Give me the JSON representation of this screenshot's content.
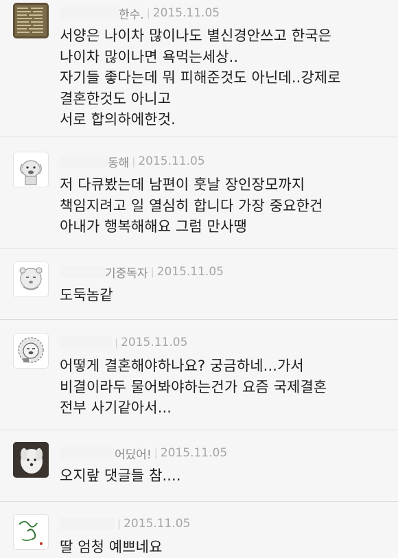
{
  "comments": [
    {
      "author": "한수.",
      "date": "2015.11.05",
      "text": "서양은 나이차 많이나도 별신경안쓰고 한국은\n나이차 많이나면 욕먹는세상..\n자기들 좋다는데 뭐 피해준것도 아닌데..강제로\n결혼한것도 아니고\n서로 합의하에한것."
    },
    {
      "author": "동해",
      "date": "2015.11.05",
      "text": "저 다큐봤는데 남편이 훗날 장인장모까지\n책임지려고 일 열심히 합니다 가장 중요한건\n아내가 행복해해요 그럼 만사땡"
    },
    {
      "author": "기중독자",
      "date": "2015.11.05",
      "text": "도둑놈같"
    },
    {
      "author": "",
      "date": "2015.11.05",
      "text": "어떻게 결혼해야하나요? 궁금하네...가서\n비결이라두 물어봐야하는건가 요즘 국제결혼\n전부 사기같아서..."
    },
    {
      "author": "어딨어!",
      "date": "2015.11.05",
      "text": "오지랖 댓글들 참...."
    },
    {
      "author": "",
      "date": "2015.11.05",
      "text": "딸 엄청 예쁘네요"
    }
  ]
}
